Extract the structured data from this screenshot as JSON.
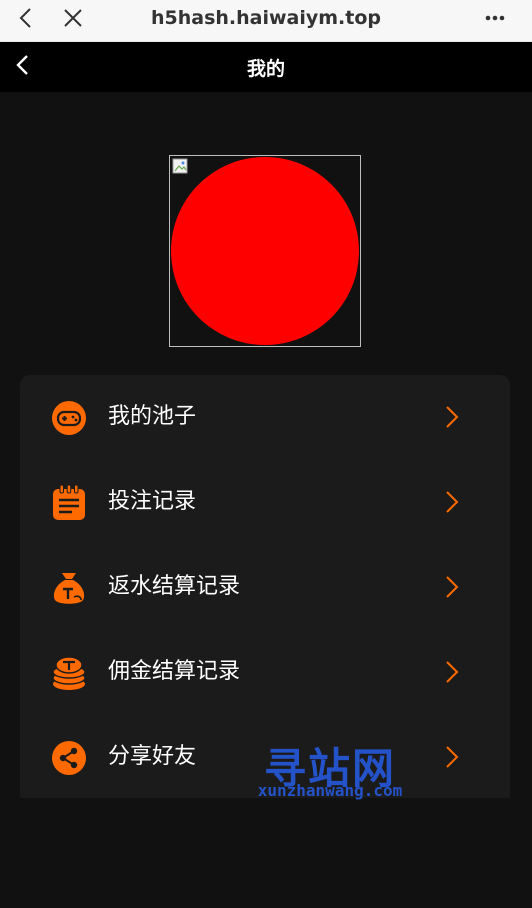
{
  "browser": {
    "url": "h5hash.haiwaiym.top"
  },
  "header": {
    "title": "我的"
  },
  "menu": {
    "items": [
      {
        "label": "我的池子",
        "icon": "gamepad-icon"
      },
      {
        "label": "投注记录",
        "icon": "notepad-icon"
      },
      {
        "label": "返水结算记录",
        "icon": "money-bag-icon"
      },
      {
        "label": "佣金结算记录",
        "icon": "coin-stack-icon"
      },
      {
        "label": "分享好友",
        "icon": "share-icon"
      }
    ]
  },
  "watermark": {
    "title": "寻站网",
    "domain": "xunzhanwang.com"
  },
  "colors": {
    "accent": "#ff6a00",
    "avatar": "#ff0000",
    "card_bg": "#1b1b1b",
    "page_bg": "#111111"
  }
}
